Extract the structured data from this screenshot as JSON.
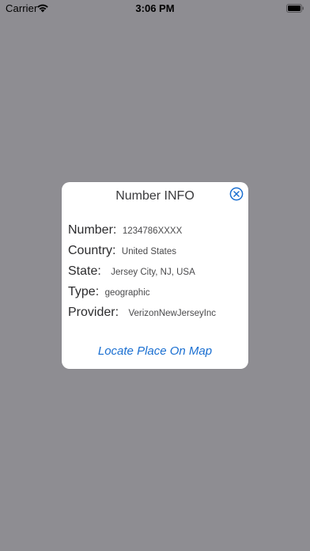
{
  "status_bar": {
    "carrier": "Carrier",
    "time": "3:06 PM"
  },
  "dialog": {
    "title": "Number INFO",
    "close_icon": "close-circle-icon",
    "rows": {
      "number": {
        "label": "Number:",
        "value": "1234786XXXX"
      },
      "country": {
        "label": "Country:",
        "value": "United States"
      },
      "state": {
        "label": "State:",
        "value": "Jersey City, NJ, USA"
      },
      "type": {
        "label": "Type:",
        "value": "geographic"
      },
      "provider": {
        "label": "Provider:",
        "value": "VerizonNewJerseyInc"
      }
    },
    "link_label": "Locate Place On Map"
  },
  "colors": {
    "overlay_background": "#8e8d92",
    "dialog_background": "#ffffff",
    "accent_blue": "#1a6fd1"
  }
}
